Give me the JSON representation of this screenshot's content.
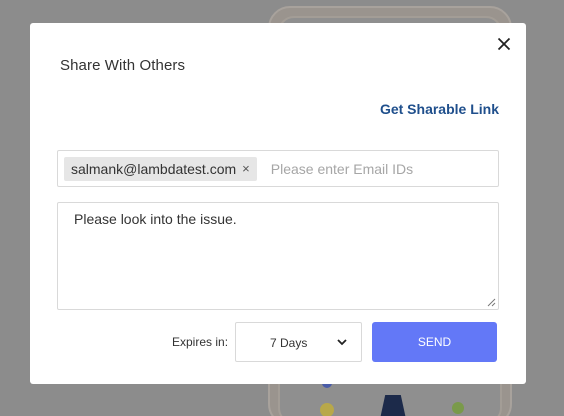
{
  "dialog": {
    "title": "Share With Others",
    "get_link_label": "Get Sharable Link",
    "email_chip": "salmank@lambdatest.com",
    "chip_remove": "×",
    "email_placeholder": "Please enter Email IDs",
    "message_value": "Please look into the issue.",
    "expires_label": "Expires in:",
    "expires_value": "7 Days",
    "send_label": "SEND"
  },
  "icons": {
    "close": "close-icon",
    "chevron": "chevron-down-icon",
    "resize": "resize-grip-icon"
  },
  "colors": {
    "backdrop": "#8c8c8c",
    "link": "#1f4f8c",
    "send_button": "#6378f7",
    "chip_bg": "#e6e6e6"
  }
}
